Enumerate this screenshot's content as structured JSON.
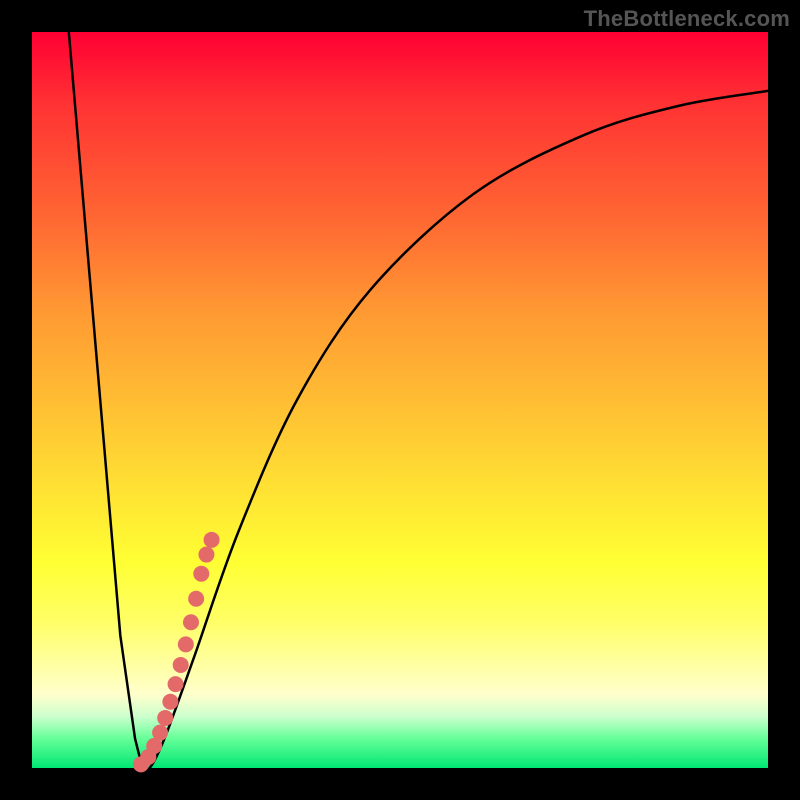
{
  "attribution": "TheBottleneck.com",
  "colors": {
    "frame": "#000000",
    "curve": "#000000",
    "dots": "#e46a6a",
    "curve_width": 2.5,
    "dot_radius": 8
  },
  "chart_data": {
    "type": "line",
    "title": "",
    "xlabel": "",
    "ylabel": "",
    "xlim": [
      0,
      100
    ],
    "ylim": [
      0,
      100
    ],
    "grid": false,
    "series": [
      {
        "name": "curve",
        "x": [
          5,
          12,
          14,
          15,
          16,
          18,
          22,
          28,
          36,
          46,
          60,
          75,
          88,
          100
        ],
        "y": [
          100,
          18,
          4,
          0,
          0,
          4,
          15,
          32,
          50,
          65,
          78,
          86,
          90,
          92
        ]
      }
    ],
    "dots": {
      "name": "highlight",
      "x": [
        14.8,
        15.8,
        16.6,
        17.4,
        18.1,
        18.8,
        19.5,
        20.2,
        20.9,
        21.6,
        22.3,
        23.0,
        23.7,
        24.4
      ],
      "y": [
        0.5,
        1.5,
        3.0,
        4.8,
        6.8,
        9.0,
        11.4,
        14.0,
        16.8,
        19.8,
        23.0,
        26.4,
        29.0,
        31.0
      ]
    }
  }
}
